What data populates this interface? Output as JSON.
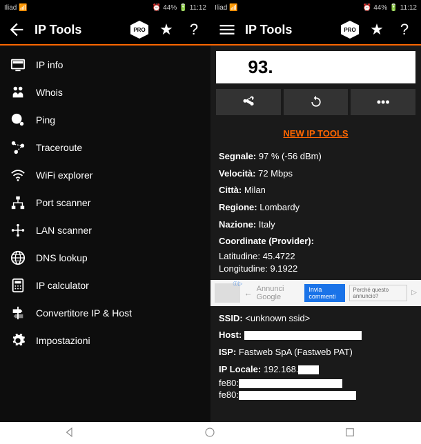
{
  "status": {
    "carrier": "Iliad",
    "battery": "44%",
    "time": "11:12"
  },
  "header": {
    "title": "IP Tools",
    "pro": "PRO"
  },
  "menu": {
    "items": [
      {
        "label": "IP info"
      },
      {
        "label": "Whois"
      },
      {
        "label": "Ping"
      },
      {
        "label": "Traceroute"
      },
      {
        "label": "WiFi explorer"
      },
      {
        "label": "Port scanner"
      },
      {
        "label": "LAN scanner"
      },
      {
        "label": "DNS lookup"
      },
      {
        "label": "IP calculator"
      },
      {
        "label": "Convertitore IP & Host"
      },
      {
        "label": "Impostazioni"
      }
    ]
  },
  "ip": {
    "visible": "93."
  },
  "link": {
    "text": "NEW IP TOOLS"
  },
  "info": {
    "segnale_label": "Segnale:",
    "segnale_value": "97 % (-56 dBm)",
    "velocita_label": "Velocità:",
    "velocita_value": "72 Mbps",
    "citta_label": "Città:",
    "citta_value": "Milan",
    "regione_label": "Regione:",
    "regione_value": "Lombardy",
    "nazione_label": "Nazione:",
    "nazione_value": "Italy",
    "coord_label": "Coordinate (Provider):",
    "lat_label": "Latitudine:",
    "lat_value": "45.4722",
    "lon_label": "Longitudine:",
    "lon_value": "9.1922",
    "ssid_label": "SSID:",
    "ssid_value": "<unknown ssid>",
    "host_label": "Host:",
    "isp_label": "ISP:",
    "isp_value": "Fastweb SpA (Fastweb PAT)",
    "iplocale_label": "IP Locale:",
    "iplocale_value": "192.168.",
    "fe80a": "fe80:",
    "fe80b": "fe80:"
  },
  "ad": {
    "title": "Annunci Google",
    "btn1": "Invia commenti",
    "btn2": "Perché questo annuncio?"
  }
}
